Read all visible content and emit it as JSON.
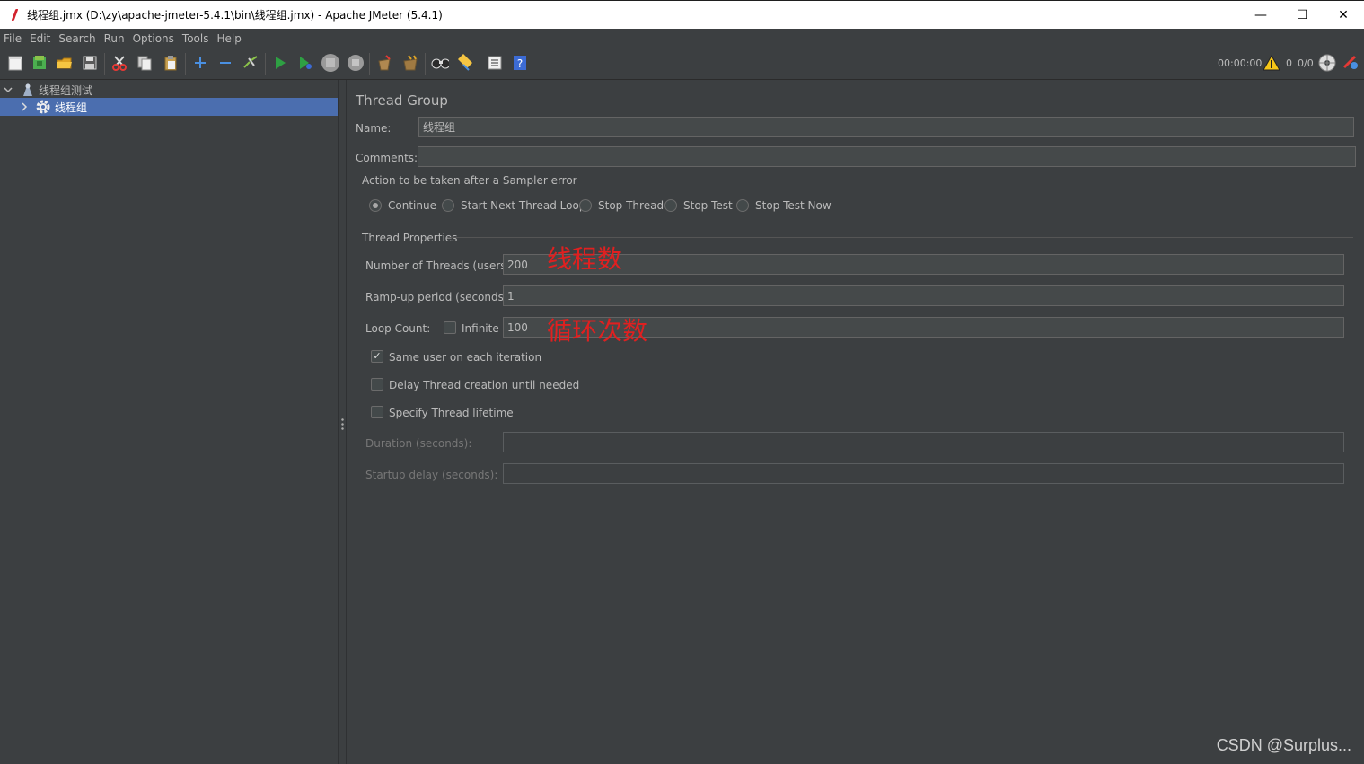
{
  "window": {
    "title": "线程组.jmx (D:\\zy\\apache-jmeter-5.4.1\\bin\\线程组.jmx) - Apache JMeter (5.4.1)",
    "minimize": "—",
    "maximize": "☐",
    "close": "✕"
  },
  "menubar": [
    "File",
    "Edit",
    "Search",
    "Run",
    "Options",
    "Tools",
    "Help"
  ],
  "status": {
    "elapsed": "00:00:00",
    "warnings": "0",
    "threads": "0/0"
  },
  "tree": {
    "root": "线程组测试",
    "child": "线程组"
  },
  "thread_group": {
    "panel_title": "Thread Group",
    "name_label": "Name:",
    "name_value": "线程组",
    "comments_label": "Comments:",
    "comments_value": "",
    "sampler_error_title": "Action to be taken after a Sampler error",
    "actions": [
      {
        "label": "Continue",
        "selected": true
      },
      {
        "label": "Start Next Thread Loop",
        "selected": false
      },
      {
        "label": "Stop Thread",
        "selected": false
      },
      {
        "label": "Stop Test",
        "selected": false
      },
      {
        "label": "Stop Test Now",
        "selected": false
      }
    ],
    "properties_title": "Thread Properties",
    "threads_label": "Number of Threads (users):",
    "threads_value": "200",
    "rampup_label": "Ramp-up period (seconds):",
    "rampup_value": "1",
    "loop_label": "Loop Count:",
    "infinite_label": "Infinite",
    "infinite_checked": false,
    "loop_value": "100",
    "same_user_label": "Same user on each iteration",
    "same_user_checked": true,
    "delay_label": "Delay Thread creation until needed",
    "delay_checked": false,
    "lifetime_label": "Specify Thread lifetime",
    "lifetime_checked": false,
    "duration_label": "Duration (seconds):",
    "duration_value": "",
    "startup_label": "Startup delay (seconds):",
    "startup_value": ""
  },
  "annotations": {
    "threads_note": "线程数",
    "loop_note": "循环次数"
  },
  "watermark": "CSDN @Surplus...",
  "colors": {
    "background": "#3c3f41",
    "selection": "#4b6eaf",
    "annotation": "#e02020"
  }
}
